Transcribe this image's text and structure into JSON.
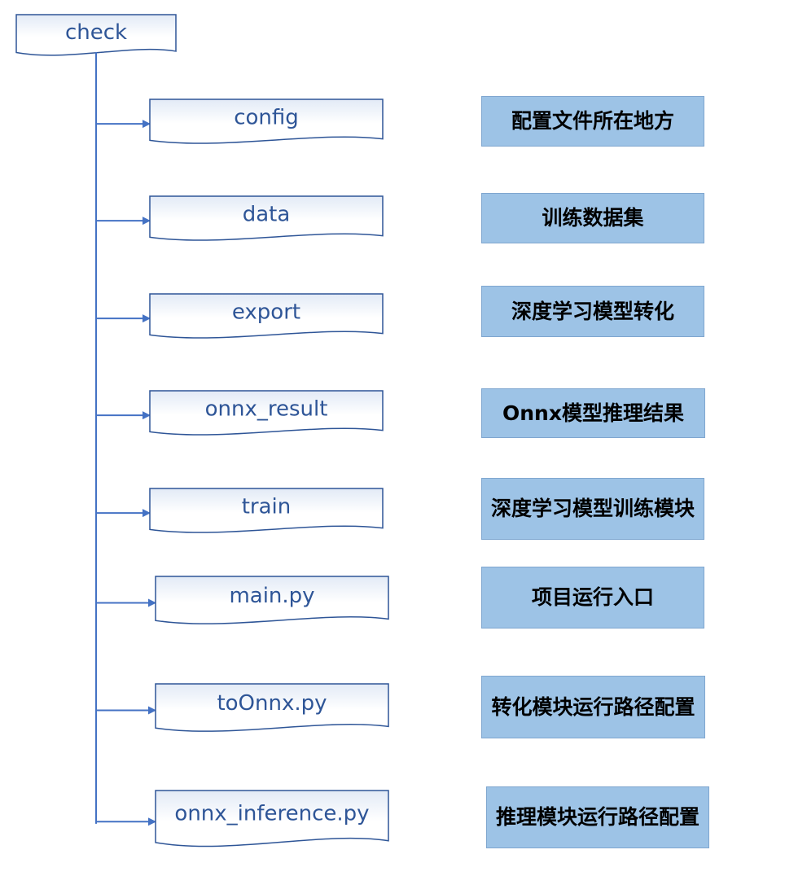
{
  "root": {
    "label": "check"
  },
  "items": [
    {
      "name": "config",
      "description": "配置文件所在地方"
    },
    {
      "name": "data",
      "description": "训练数据集"
    },
    {
      "name": "export",
      "description": "深度学习模型转化"
    },
    {
      "name": "onnx_result",
      "description": "Onnx模型推理结果"
    },
    {
      "name": "train",
      "description": "深度学习模型训练模块"
    },
    {
      "name": "main.py",
      "description": "项目运行入口"
    },
    {
      "name": "toOnnx.py",
      "description": "转化模块运行路径配置"
    },
    {
      "name": "onnx_inference.py",
      "description": "推理模块运行路径配置"
    }
  ],
  "colors": {
    "line": "#4472C4",
    "doc_border": "#2E5597",
    "doc_text": "#2E5597",
    "desc_fill": "#9DC3E6"
  }
}
